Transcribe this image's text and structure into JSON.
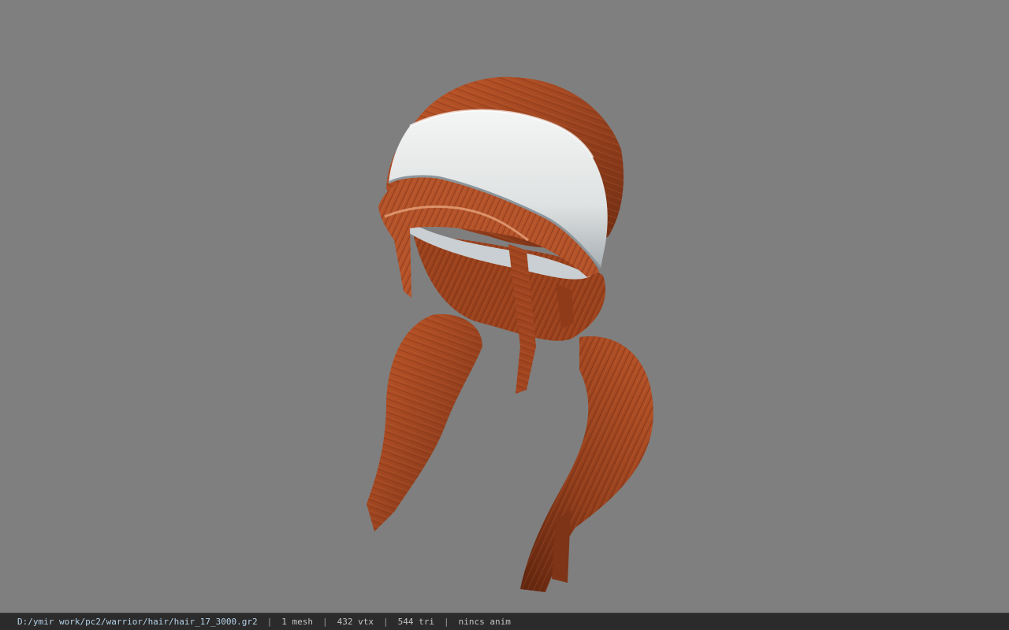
{
  "viewer": {
    "background_color": "#7f7f7f",
    "model": {
      "name": "hair_17_3000",
      "hair_color": "#a84a22",
      "band_color": "#e6e8e8"
    }
  },
  "status_bar": {
    "file_path": "D:/ymir work/pc2/warrior/hair/hair_17_3000.gr2",
    "separator": "|",
    "mesh_count": "1 mesh",
    "vertex_count": "432 vtx",
    "triangle_count": "544 tri",
    "anim_status": "nincs anim"
  }
}
